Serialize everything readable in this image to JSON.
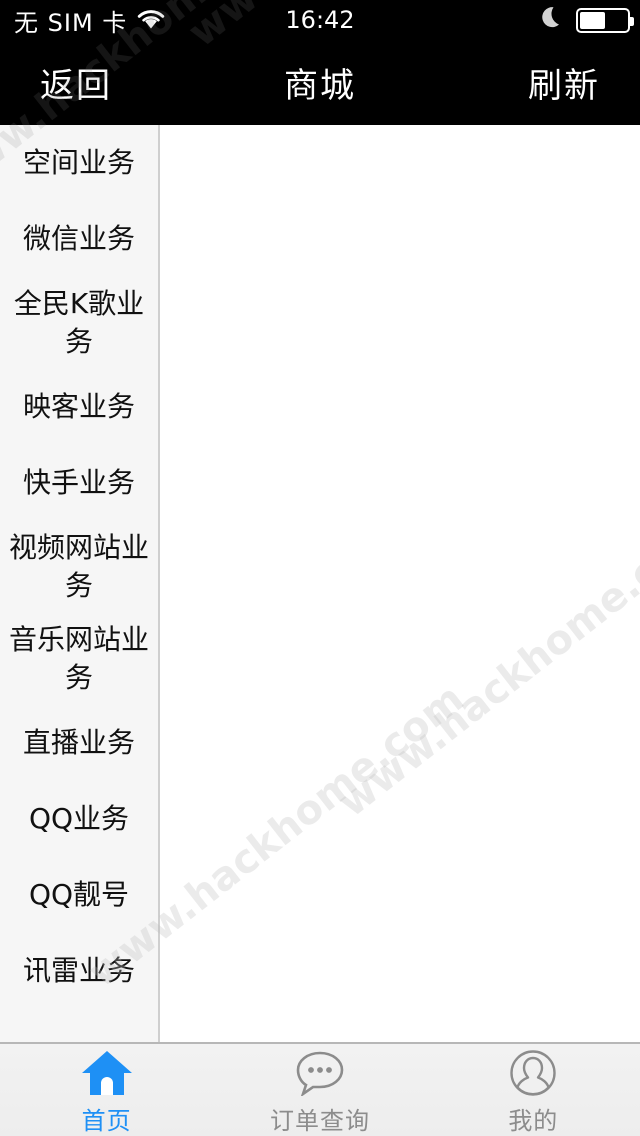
{
  "status_bar": {
    "carrier": "无 SIM 卡",
    "wifi_icon": "wifi-icon",
    "time": "16:42",
    "moon_icon": "moon-icon",
    "battery_icon": "battery-icon",
    "battery_level_percent": 55
  },
  "nav_bar": {
    "back_label": "返回",
    "title": "商城",
    "refresh_label": "刷新",
    "background_color": "#000000",
    "text_color": "#ffffff"
  },
  "sidebar": {
    "background_color": "#f6f6f6",
    "items": [
      {
        "label": "空间业务"
      },
      {
        "label": "微信业务"
      },
      {
        "label": "全民K歌业务"
      },
      {
        "label": "映客业务"
      },
      {
        "label": "快手业务"
      },
      {
        "label": "视频网站业务"
      },
      {
        "label": "音乐网站业务"
      },
      {
        "label": "直播业务"
      },
      {
        "label": "QQ业务"
      },
      {
        "label": "QQ靓号"
      },
      {
        "label": "讯雷业务"
      }
    ]
  },
  "main_panel": {
    "content": "",
    "background_color": "#ffffff"
  },
  "tab_bar": {
    "accent_color": "#1e90f5",
    "inactive_color": "#8c8c8c",
    "tabs": [
      {
        "label": "首页",
        "icon": "home-icon",
        "active": true
      },
      {
        "label": "订单查询",
        "icon": "chat-bubble-icon",
        "active": false
      },
      {
        "label": "我的",
        "icon": "person-icon",
        "active": false
      }
    ]
  },
  "watermark": {
    "text": "www.hackhome.com"
  }
}
